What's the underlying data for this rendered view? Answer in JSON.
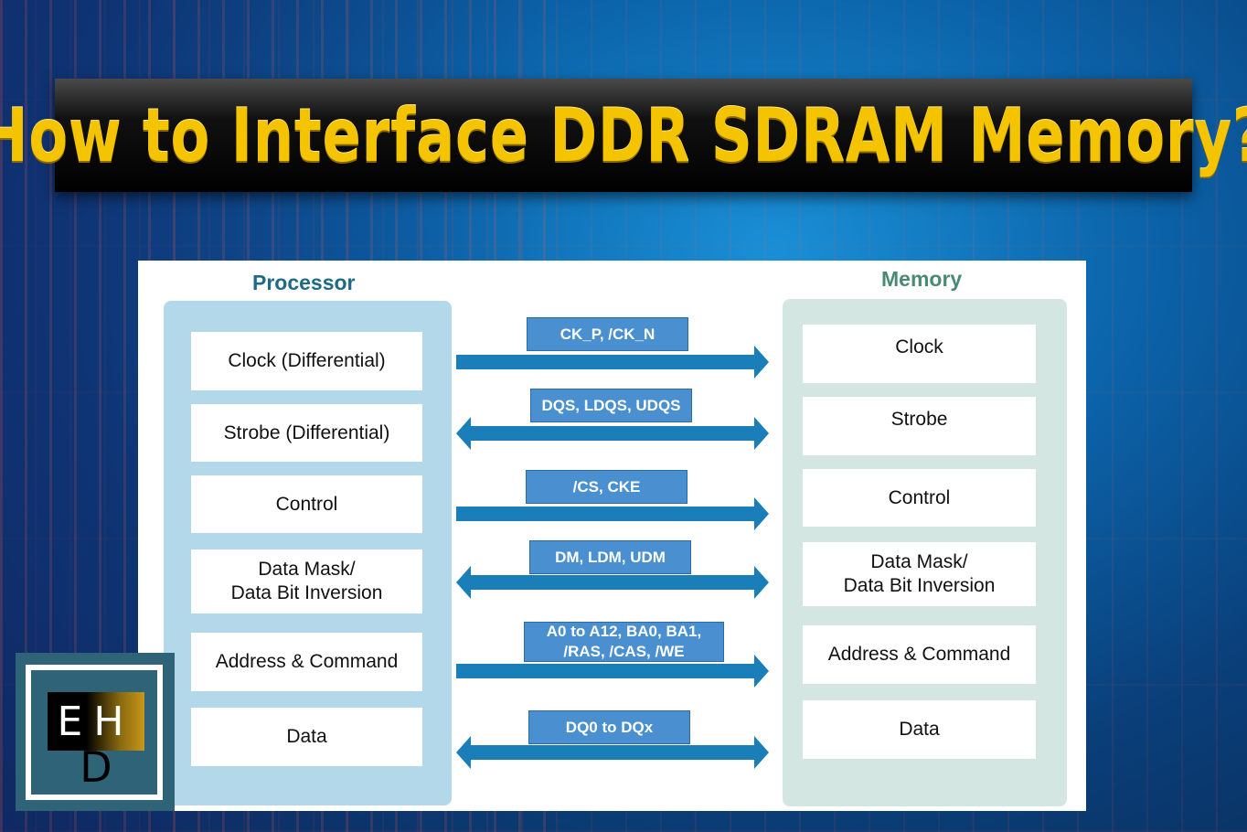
{
  "title": "How to Interface DDR SDRAM Memory?",
  "colors": {
    "title_text": "#f5c400",
    "processor_heading": "#1f6b86",
    "memory_heading": "#4a8a72",
    "processor_panel": "#b3d8ea",
    "memory_panel": "#d3e6e2",
    "arrow": "#1a7fb8",
    "signal_label_bg": "#4a90d0"
  },
  "diagram": {
    "processor": {
      "heading": "Processor",
      "blocks": [
        "Clock (Differential)",
        "Strobe (Differential)",
        "Control",
        "Data Mask/\nData Bit Inversion",
        "Address & Command",
        "Data"
      ]
    },
    "memory": {
      "heading": "Memory",
      "blocks": [
        "Clock",
        "Strobe",
        "Control",
        "Data Mask/\nData Bit Inversion",
        "Address & Command",
        "Data"
      ]
    },
    "connections": [
      {
        "signals": "CK_P, /CK_N",
        "direction": "processor-to-memory"
      },
      {
        "signals": "DQS, LDQS, UDQS",
        "direction": "bidirectional"
      },
      {
        "signals": "/CS, CKE",
        "direction": "processor-to-memory"
      },
      {
        "signals": "DM, LDM, UDM",
        "direction": "bidirectional"
      },
      {
        "signals": "A0 to A12, BA0, BA1,\n/RAS, /CAS, /WE",
        "direction": "processor-to-memory"
      },
      {
        "signals": "DQ0 to DQx",
        "direction": "bidirectional"
      }
    ]
  },
  "logo": {
    "top_letters": "EH",
    "bottom_letter": "D"
  }
}
